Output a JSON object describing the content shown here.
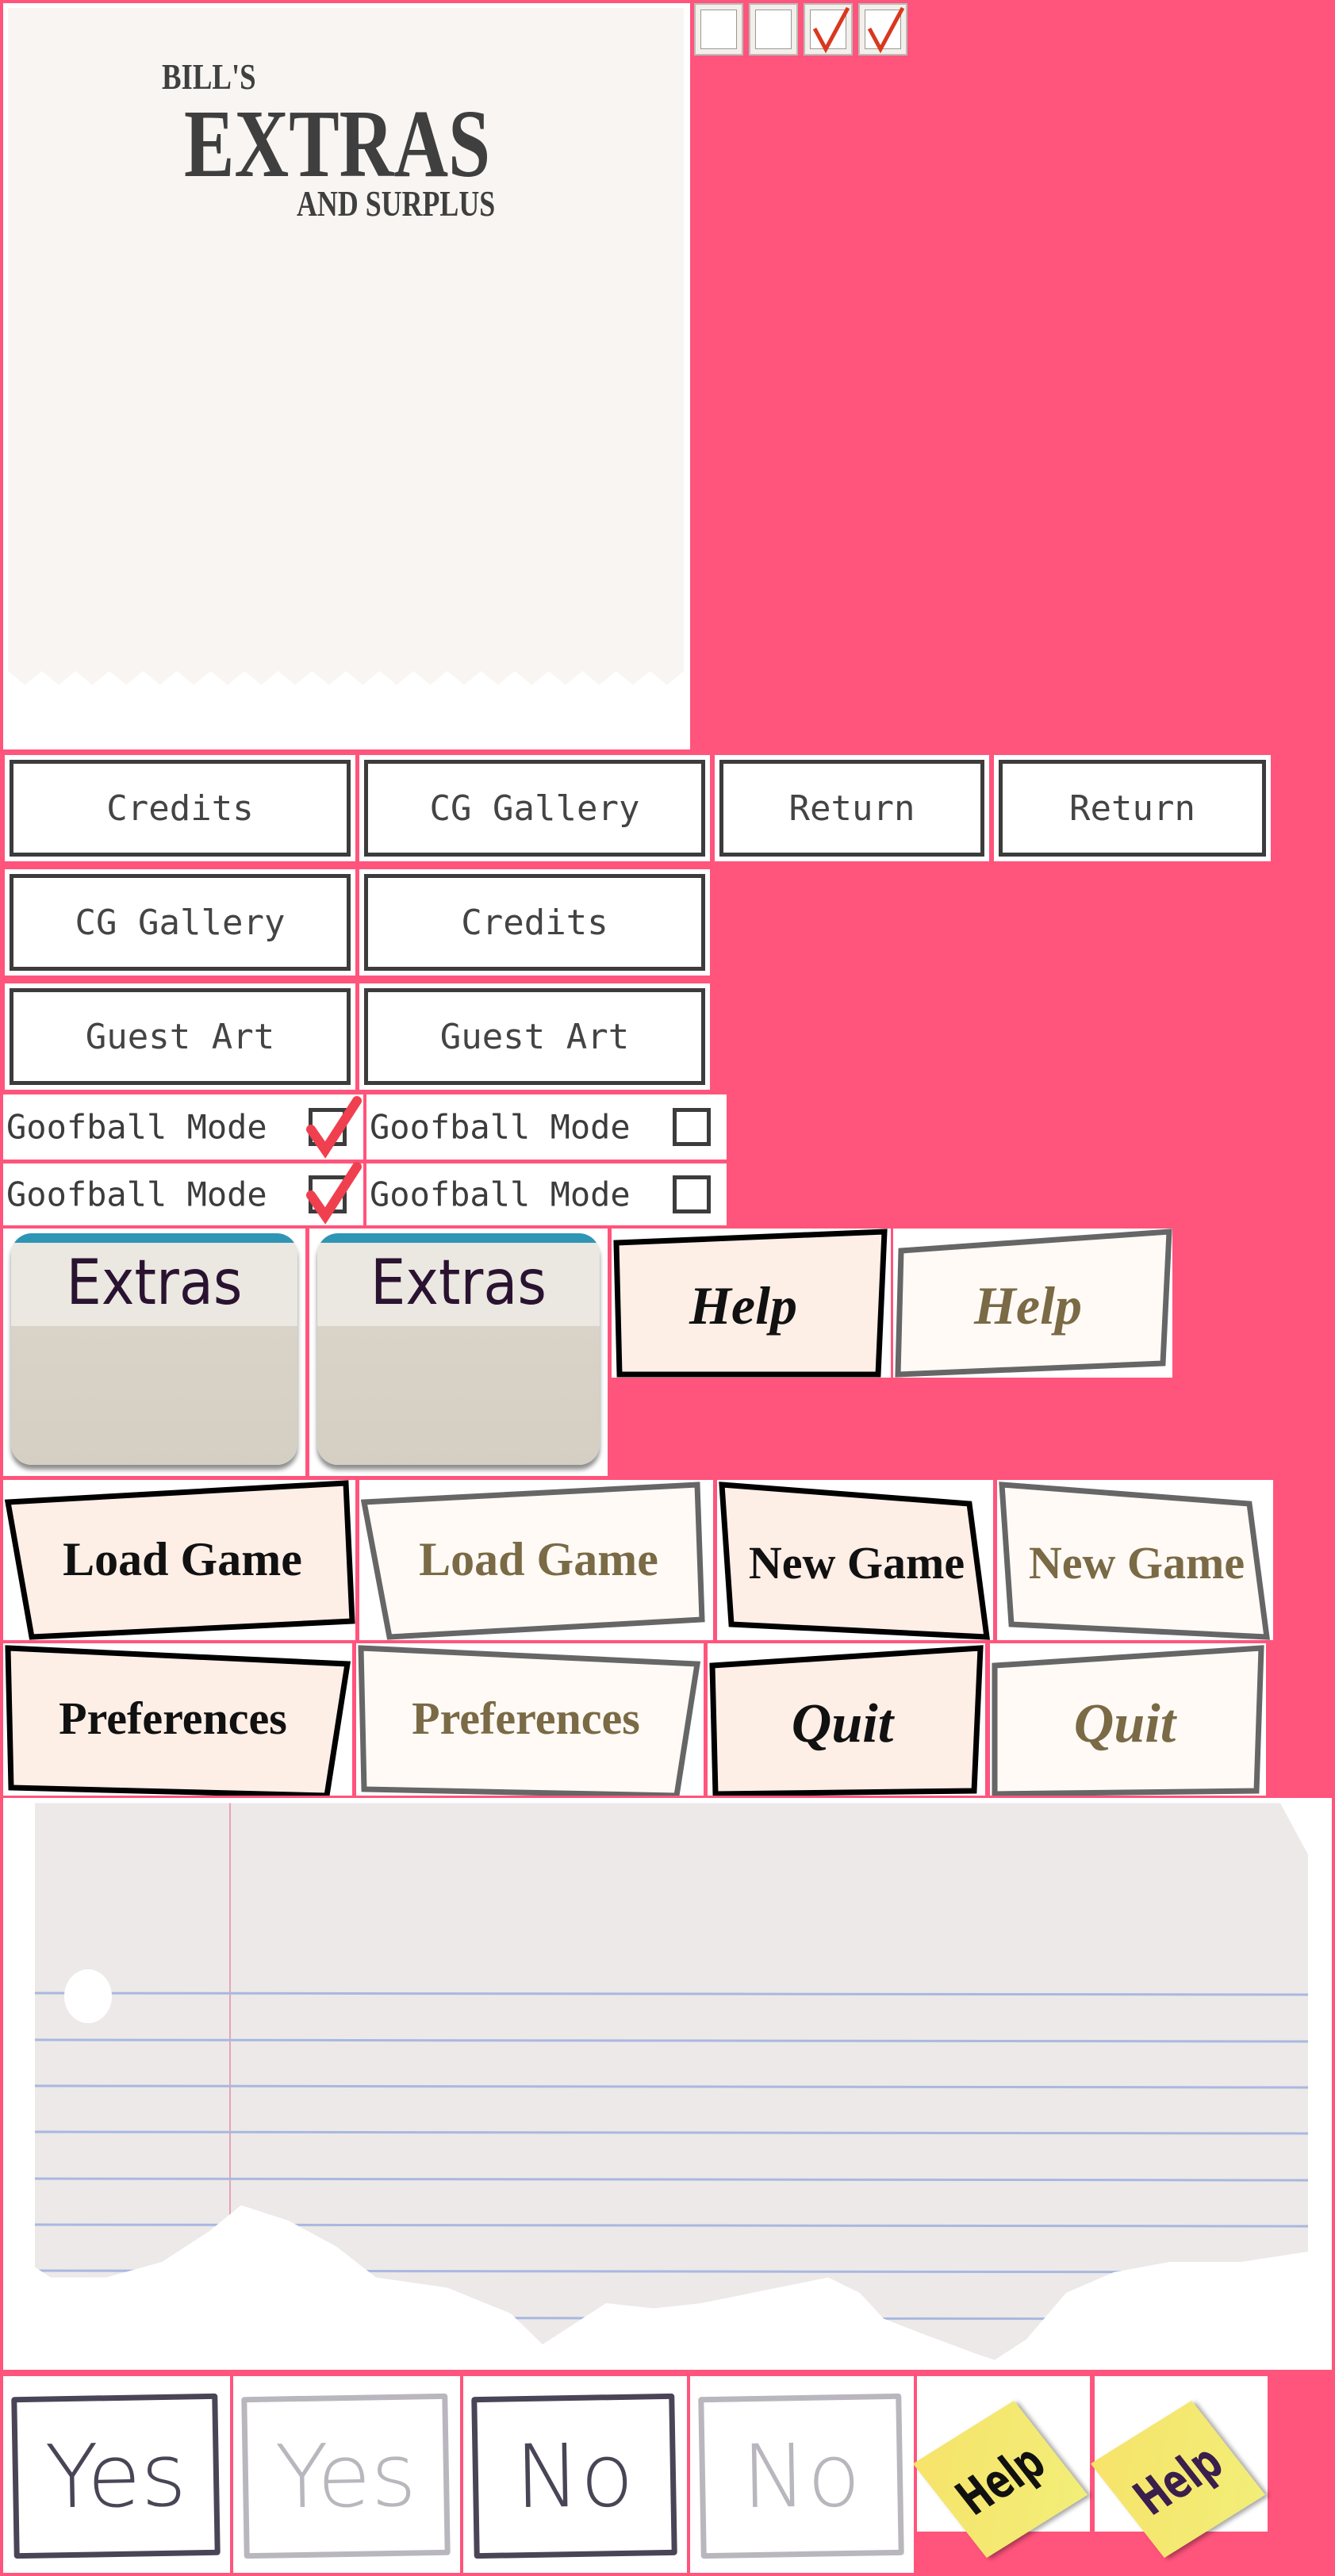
{
  "receipt": {
    "line1": "BILL'S",
    "line2": "EXTRAS",
    "line3": "AND SURPLUS"
  },
  "checkboxes": [
    {
      "state": "unchecked"
    },
    {
      "state": "unchecked"
    },
    {
      "state": "checked"
    },
    {
      "state": "checked"
    }
  ],
  "menu_buttons": {
    "row1": [
      "Credits",
      "CG Gallery",
      "Return",
      "Return"
    ],
    "row2": [
      "CG Gallery",
      "Credits"
    ],
    "row3": [
      "Guest Art",
      "Guest Art"
    ]
  },
  "toggles": [
    {
      "label": "Goofball Mode",
      "checked": true
    },
    {
      "label": "Goofball Mode",
      "checked": false
    },
    {
      "label": "Goofball Mode",
      "checked": true
    },
    {
      "label": "Goofball Mode",
      "checked": false
    }
  ],
  "tabs": [
    "Extras",
    "Extras"
  ],
  "help_buttons": [
    "Help",
    "Help"
  ],
  "main_menu": {
    "row1": [
      "Load Game",
      "Load Game",
      "New Game",
      "New Game"
    ],
    "row2": [
      "Preferences",
      "Preferences",
      "Quit",
      "Quit"
    ]
  },
  "dialog_buttons": [
    "Yes",
    "Yes",
    "No",
    "No"
  ],
  "sticky_help": [
    "Help",
    "Help"
  ],
  "colors": {
    "background": "#ff547c",
    "active_text": "#111111",
    "idle_text": "#7a6a45",
    "check": "#d9381e",
    "toggle_check": "#f0404f"
  }
}
